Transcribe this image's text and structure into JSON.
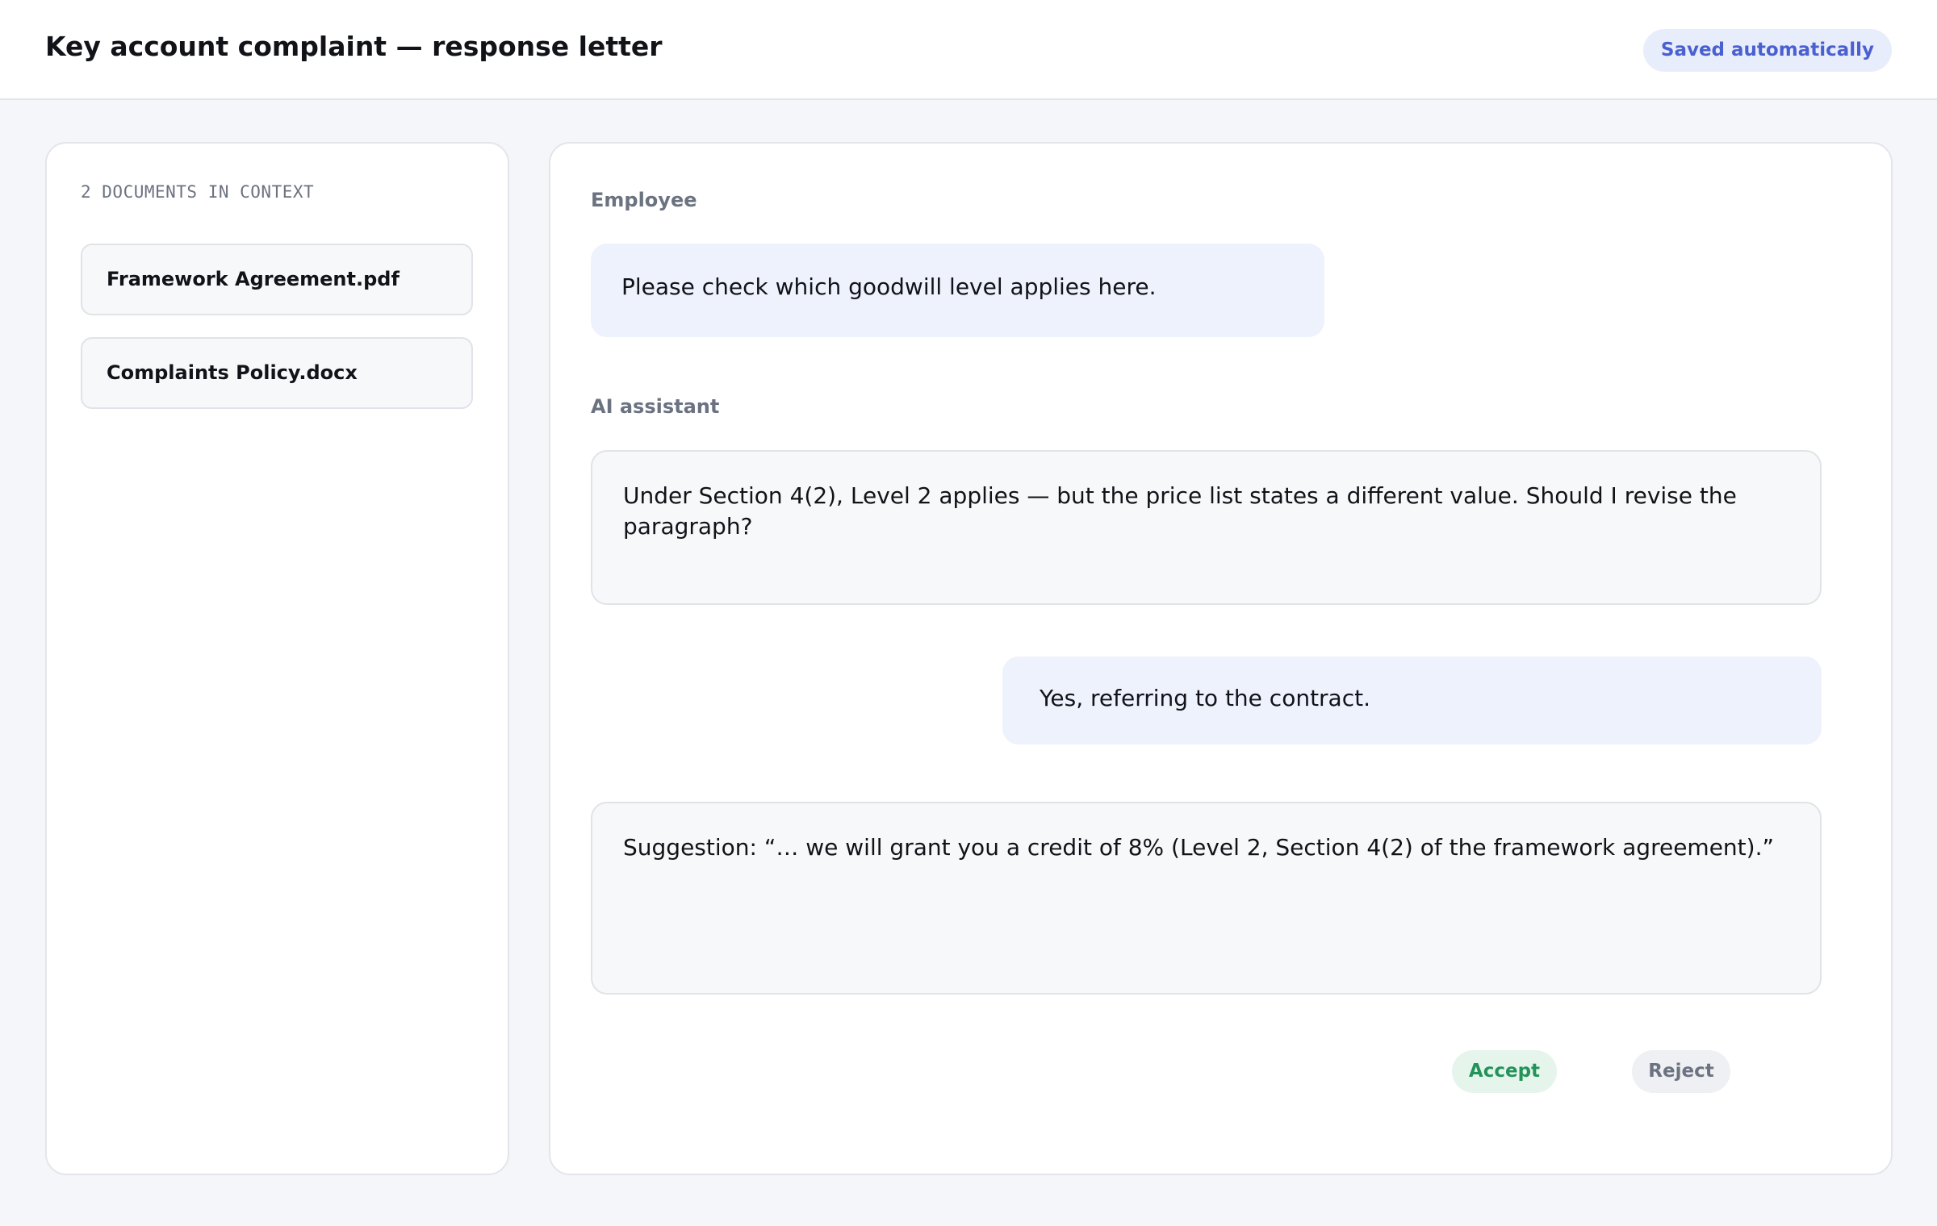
{
  "header": {
    "title": "Key account complaint — response letter",
    "status_badge": "Saved automatically"
  },
  "sidebar": {
    "context_label": "2 DOCUMENTS IN CONTEXT",
    "documents": [
      {
        "name": "Framework Agreement.pdf"
      },
      {
        "name": "Complaints Policy.docx"
      }
    ]
  },
  "chat": {
    "messages": [
      {
        "speaker": "Employee",
        "text": "Please check which goodwill level applies here."
      },
      {
        "speaker": "AI assistant",
        "text": "Under Section 4(2), Level 2 applies — but the price list states a different value. Should I revise the paragraph?"
      },
      {
        "speaker": "",
        "text": "Yes, referring to the contract."
      },
      {
        "speaker": "",
        "text": "Suggestion: “… we will grant you a credit of 8% (Level 2, Section 4(2) of the framework agreement).”"
      }
    ],
    "actions": {
      "accept_label": "Accept",
      "reject_label": "Reject"
    }
  },
  "colors": {
    "accent": "#4a5fd0",
    "accept": "#23935a",
    "user_bubble": "#eef2fd",
    "ai_bubble": "#f7f8fa"
  }
}
